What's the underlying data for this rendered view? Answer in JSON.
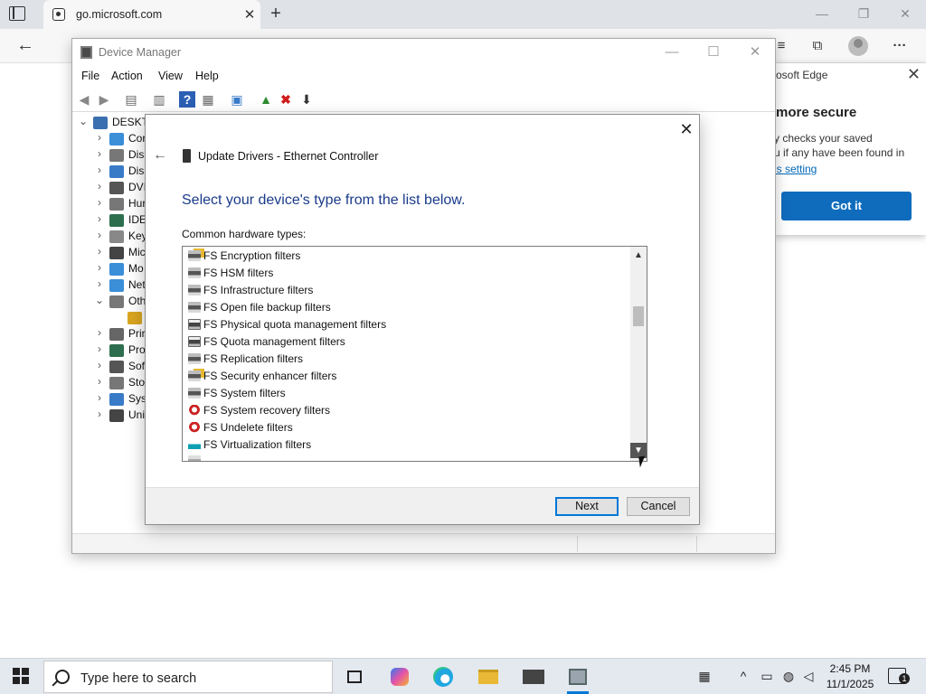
{
  "browser": {
    "tab_title": "go.microsoft.com",
    "tab_close": "✕",
    "new_tab": "+",
    "minimize": "—",
    "restore": "❐",
    "close": "✕",
    "back": "←",
    "menu": "···"
  },
  "edge_popup": {
    "header": "osoft Edge",
    "close": "✕",
    "title": "more secure",
    "line1": "y checks your saved",
    "line2": "u if any have been found in",
    "link": "is setting",
    "button": "Got it"
  },
  "device_manager": {
    "title": "Device Manager",
    "minimize": "—",
    "maximize": "☐",
    "close": "✕",
    "menu": [
      "File",
      "Action",
      "View",
      "Help"
    ],
    "tree_root": "DESKTO",
    "tree_items": [
      "Cor",
      "Disl",
      "Disp",
      "DVI",
      "Hur",
      "IDE",
      "Key",
      "Mic",
      "Mo",
      "Net",
      "Oth",
      "",
      "Prir",
      "Pro",
      "Sof",
      "Sto",
      "Syst",
      "Uni"
    ],
    "toolbar_icons": [
      "back-arrow-icon",
      "forward-arrow-icon",
      "properties-icon",
      "show-hide-icon",
      "help-icon",
      "view-icon",
      "scan-hardware-icon",
      "update-driver-icon",
      "uninstall-icon",
      "disable-icon"
    ]
  },
  "update_drivers": {
    "close": "✕",
    "back": "←",
    "title": "Update Drivers - Ethernet Controller",
    "heading": "Select your device's type from the list below.",
    "list_label": "Common hardware types:",
    "items": [
      {
        "label": "FS Encryption filters",
        "icon": "lock-drive-icon"
      },
      {
        "label": "FS HSM filters",
        "icon": "drive-icon"
      },
      {
        "label": "FS Infrastructure filters",
        "icon": "drive-icon"
      },
      {
        "label": "FS Open file backup filters",
        "icon": "drive-icon"
      },
      {
        "label": "FS Physical quota management filters",
        "icon": "printer-drive-icon"
      },
      {
        "label": "FS Quota management filters",
        "icon": "printer-drive-icon"
      },
      {
        "label": "FS Replication filters",
        "icon": "drive-icon"
      },
      {
        "label": "FS Security enhancer filters",
        "icon": "lock-drive-icon"
      },
      {
        "label": "FS System filters",
        "icon": "drive-icon"
      },
      {
        "label": "FS System recovery filters",
        "icon": "recovery-icon"
      },
      {
        "label": "FS Undelete filters",
        "icon": "recovery-icon"
      },
      {
        "label": "FS Virtualization filters",
        "icon": "virtualization-icon"
      }
    ],
    "next": "Next",
    "cancel": "Cancel"
  },
  "taskbar": {
    "search_placeholder": "Type here to search",
    "time": "2:45 PM",
    "date": "11/1/2025",
    "notification_count": "1",
    "up_arrow": "^"
  },
  "colors": {
    "accent": "#0078d7",
    "heading_blue": "#1a3b8a",
    "popup_button": "#0f6cbd"
  }
}
